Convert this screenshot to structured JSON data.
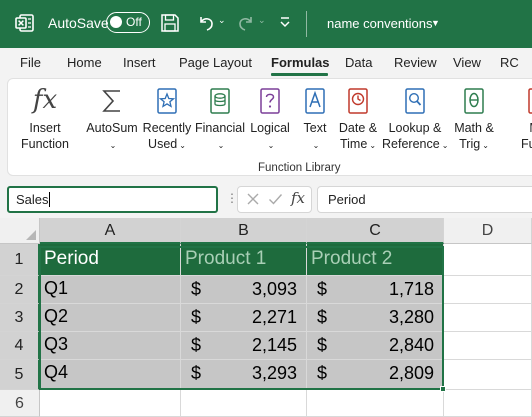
{
  "titlebar": {
    "autosave_label": "AutoSave",
    "autosave_state": "Off",
    "document_name": "name conventions",
    "bg_color": "#217346"
  },
  "ribbon_tabs": [
    "File",
    "Home",
    "Insert",
    "Page Layout",
    "Formulas",
    "Data",
    "Review",
    "View",
    "RC"
  ],
  "active_tab": "Formulas",
  "function_library": {
    "group_label": "Function Library",
    "buttons": [
      {
        "line1": "Insert",
        "line2": "Function",
        "icon": "fx-icon"
      },
      {
        "line1": "AutoSum",
        "line2": "",
        "icon": "sigma-icon"
      },
      {
        "line1": "Recently",
        "line2": "Used",
        "icon": "star-book-icon"
      },
      {
        "line1": "Financial",
        "line2": "",
        "icon": "coins-book-icon"
      },
      {
        "line1": "Logical",
        "line2": "",
        "icon": "question-book-icon"
      },
      {
        "line1": "Text",
        "line2": "",
        "icon": "text-book-icon"
      },
      {
        "line1": "Date &",
        "line2": "Time",
        "icon": "clock-book-icon"
      },
      {
        "line1": "Lookup &",
        "line2": "Reference",
        "icon": "magnifier-book-icon"
      },
      {
        "line1": "Math &",
        "line2": "Trig",
        "icon": "theta-book-icon"
      },
      {
        "line1": "Mo",
        "line2": "Functi",
        "icon": "more-book-icon"
      }
    ]
  },
  "formula_bar": {
    "name_box": "Sales",
    "fx_label": "fx",
    "formula": "Period"
  },
  "grid": {
    "columns": [
      "A",
      "B",
      "C",
      "D"
    ],
    "rows": [
      "1",
      "2",
      "3",
      "4",
      "5",
      "6"
    ],
    "header_row": [
      "Period",
      "Product 1",
      "Product 2"
    ],
    "currency_symbol": "$",
    "data_rows": [
      {
        "period": "Q1",
        "p1": "3,093",
        "p2": "1,718"
      },
      {
        "period": "Q2",
        "p1": "2,271",
        "p2": "3,280"
      },
      {
        "period": "Q3",
        "p1": "2,145",
        "p2": "2,840"
      },
      {
        "period": "Q4",
        "p1": "3,293",
        "p2": "2,809"
      }
    ],
    "selection": "A1:C5",
    "header_fill": "#1e6b3d",
    "selected_fill": "#c6c6c6"
  }
}
